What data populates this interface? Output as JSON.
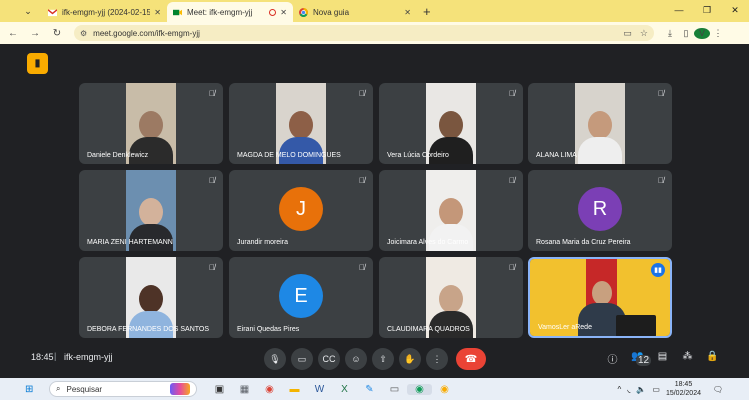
{
  "browser": {
    "tabs": [
      {
        "title": "ifk-emgm-yjj (2024-02-15 20:4",
        "icon": "gmail-icon",
        "active": false
      },
      {
        "title": "Meet: ifk-emgm-yjj",
        "icon": "meet-icon",
        "active": true
      },
      {
        "title": "Nova guia",
        "icon": "chrome-icon",
        "active": false
      }
    ],
    "url": "meet.google.com/ifk-emgm-yjj",
    "profile_initial": "V",
    "colors": {
      "frame": "#f5e27a",
      "toolbar": "#fffbe6"
    }
  },
  "meeting": {
    "time": "18:45",
    "separator": "|",
    "code": "ifk-emgm-yjj",
    "people_count": "12",
    "participants": [
      {
        "name": "Daniele Denklewicz",
        "kind": "video",
        "skin": "#9c7a63",
        "shirt": "#2b2b2b",
        "bg": "#c8bca8"
      },
      {
        "name": "MAGDA DE MELO DOMINGUES",
        "kind": "video",
        "skin": "#8d5f47",
        "shirt": "#3459a8",
        "bg": "#d9d4cd"
      },
      {
        "name": "Vera Lúcia Cordeiro",
        "kind": "video",
        "skin": "#7a563f",
        "shirt": "#1f1f1f",
        "bg": "#e9e7e4"
      },
      {
        "name": "ALANA LIMA",
        "kind": "video",
        "skin": "#c59a7c",
        "shirt": "#eeeeee",
        "bg": "#d7d3cc"
      },
      {
        "name": "MARIA ZENI HARTEMANN",
        "kind": "video",
        "skin": "#d3b29b",
        "shirt": "#28292d",
        "bg": "#6c8fb0"
      },
      {
        "name": "Jurandir moreira",
        "kind": "avatar",
        "initial": "J",
        "color": "#e8710a"
      },
      {
        "name": "Joicimara Alves do Carmo",
        "kind": "video",
        "skin": "#c49779",
        "shirt": "#f2f2f2",
        "bg": "#efeeec"
      },
      {
        "name": "Rosana Maria da Cruz Pereira",
        "kind": "avatar",
        "initial": "R",
        "color": "#7b3fb5"
      },
      {
        "name": "DEBORA FERNANDES DOS SANTOS",
        "kind": "video",
        "skin": "#4e3327",
        "shirt": "#8fb4de",
        "bg": "#e9e9e9"
      },
      {
        "name": "Eirani Quedas Pires",
        "kind": "avatar",
        "initial": "E",
        "color": "#1e88e5"
      },
      {
        "name": "CLAUDIMARA QUADROS",
        "kind": "video",
        "skin": "#c8a489",
        "shirt": "#2a2a2a",
        "bg": "#efeae3"
      },
      {
        "name": "VamosLer aRede",
        "kind": "studio",
        "speaking": true
      }
    ]
  },
  "taskbar": {
    "search_placeholder": "Pesquisar",
    "time": "18:45",
    "date": "15/02/2024"
  }
}
